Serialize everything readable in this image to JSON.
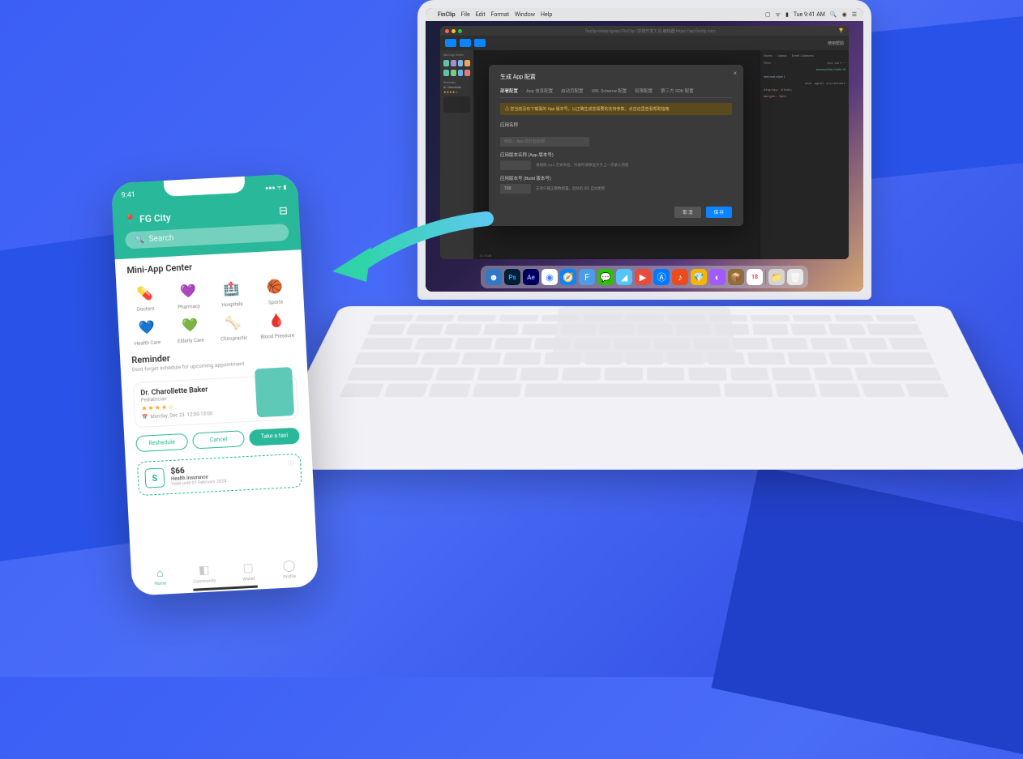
{
  "colors": {
    "brand_teal": "#29b89a",
    "brand_blue": "#3b5ef5",
    "accent": "#0a84ff"
  },
  "phone": {
    "status_time": "9:41",
    "location_city": "FG City",
    "search_placeholder": "Search",
    "section_miniapp": "Mini-App Center",
    "apps": {
      "doctors": "Doctors",
      "pharmacy": "Pharmacy",
      "hospitals": "Hospitals",
      "sports": "Sports",
      "healthcare": "Health Care",
      "elderly": "Elderly Care",
      "chiro": "Chiropractic",
      "blood": "Blood Pressure"
    },
    "reminder": {
      "title": "Reminder",
      "subtitle": "Dont forget schedule for upcoming appointment"
    },
    "doctor": {
      "name": "Dr. Charollette Baker",
      "role": "Pediatrician",
      "date_label": "Monday, Dec 23",
      "time": "12:00-13:00"
    },
    "buttons": {
      "reschedule": "Reshedule",
      "cancel": "Cancel",
      "taxi": "Take a taxi"
    },
    "price": {
      "amount": "$66",
      "label": "Health Insurance",
      "valid": "Valid until 01 February 2024",
      "icon_letter": "S"
    },
    "tabs": {
      "home": "Home",
      "community": "Community",
      "wallet": "Wallet",
      "profile": "Profile"
    }
  },
  "mac": {
    "menubar": {
      "app": "FinClip",
      "items": [
        "File",
        "Edit",
        "Format",
        "Window",
        "Help"
      ],
      "time": "Tue 9:41 AM"
    },
    "ide": {
      "title": "finclip-miniprogram/FinClip | 前端开发工具 编辑器 https://api.finclip.com",
      "toolbar_badge": "使用帮助"
    },
    "sidepanel": {
      "miniapp": "Mini-App Center",
      "reminder": "Reminder",
      "doctor": "Dr. Charollette"
    },
    "modal": {
      "title": "生成 App 配置",
      "tabs": [
        "部署配置",
        "App 信息配置",
        "启动页配置",
        "URL Scheme 配置",
        "权限配置",
        "第三方 SDK 配置"
      ],
      "warning": "您当前没有下载需的 App 版本号，以正确生成您需要的支持参数，点击这里查看帮助指南",
      "f1_label": "应用名称",
      "f1_placeholder": "例如：App 的打包名称",
      "f2_label": "应用版本名称 (App 版本号)",
      "f2_hint": "请按照 x.y.z 方式命名，升级时请保证大于上一次录入的值",
      "f3_label": "应用版本号 (Build 版本号)",
      "f3_value": "100",
      "f3_hint": "支持只输正整数配置，后续的 IDE 自动更新",
      "btn_cancel": "取 消",
      "btn_ok": "保 存"
    },
    "rightpanel": {
      "tabs": [
        "Styles",
        "Layout",
        "Event Listeners"
      ],
      "filter": "Filter",
      "selector": ":hov .cls + ⋯",
      "code1": "element.style {",
      "code1b": "}",
      "ua_label": "user agent stylesheet",
      "code2": "display: block;",
      "code3": "margin: 0px;",
      "code_file": "wxssroot.file.e16efc:18"
    },
    "console": "14:15:40"
  }
}
